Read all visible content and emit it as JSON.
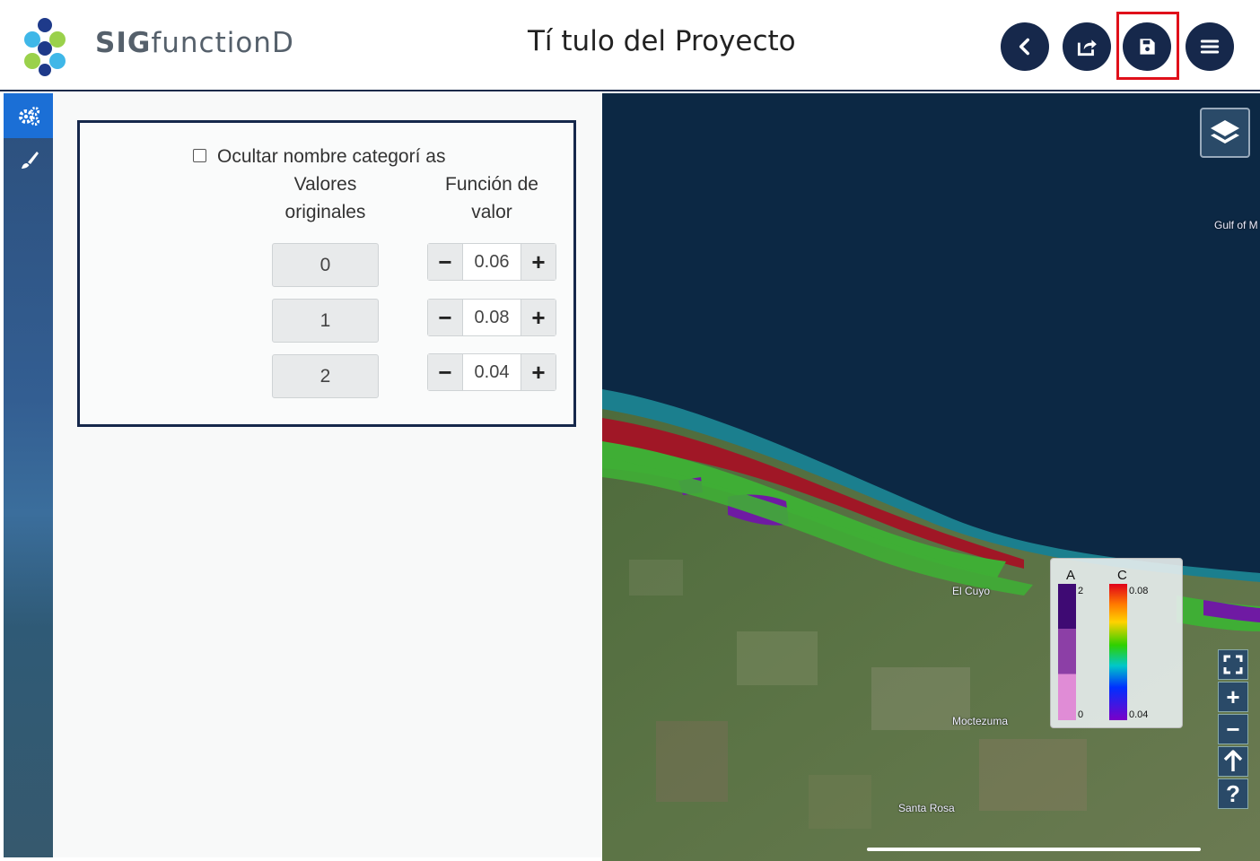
{
  "header": {
    "brand_bold": "SIG",
    "brand_rest": "functionD",
    "project_title": "Tí tulo del Proyecto",
    "buttons": [
      "back-icon",
      "share-icon",
      "save-icon",
      "menu-icon"
    ],
    "highlighted_button": "save",
    "highlight_color": "#e0101a",
    "button_color": "#16284b"
  },
  "sidebar": {
    "tabs": [
      {
        "icon": "gears-icon",
        "active": true
      },
      {
        "icon": "brush-icon",
        "active": false
      }
    ],
    "active_color": "#1b6fd6"
  },
  "panel": {
    "hide_categories_label": "Ocultar nombre categorí as",
    "hide_categories_checked": false,
    "col_original_line1": "Valores",
    "col_original_line2": "originales",
    "col_function_line1": "Función de",
    "col_function_line2": "valor",
    "rows": [
      {
        "original": "0",
        "value": "0.06"
      },
      {
        "original": "1",
        "value": "0.08"
      },
      {
        "original": "2",
        "value": "0.04"
      }
    ],
    "minus": "−",
    "plus": "+"
  },
  "map": {
    "places": [
      "Gulf of M",
      "El Cuyo",
      "Moctezuma",
      "Santa Rosa"
    ],
    "legend": {
      "a_label": "A",
      "c_label": "C",
      "a_max": "2",
      "a_min": "0",
      "c_max": "0.08",
      "c_min": "0.04"
    },
    "controls": [
      "fullscreen-icon",
      "zoom-in-icon",
      "zoom-out-icon",
      "north-arrow-icon",
      "help-icon"
    ],
    "zoom_in": "+",
    "zoom_out": "−",
    "help": "?"
  }
}
